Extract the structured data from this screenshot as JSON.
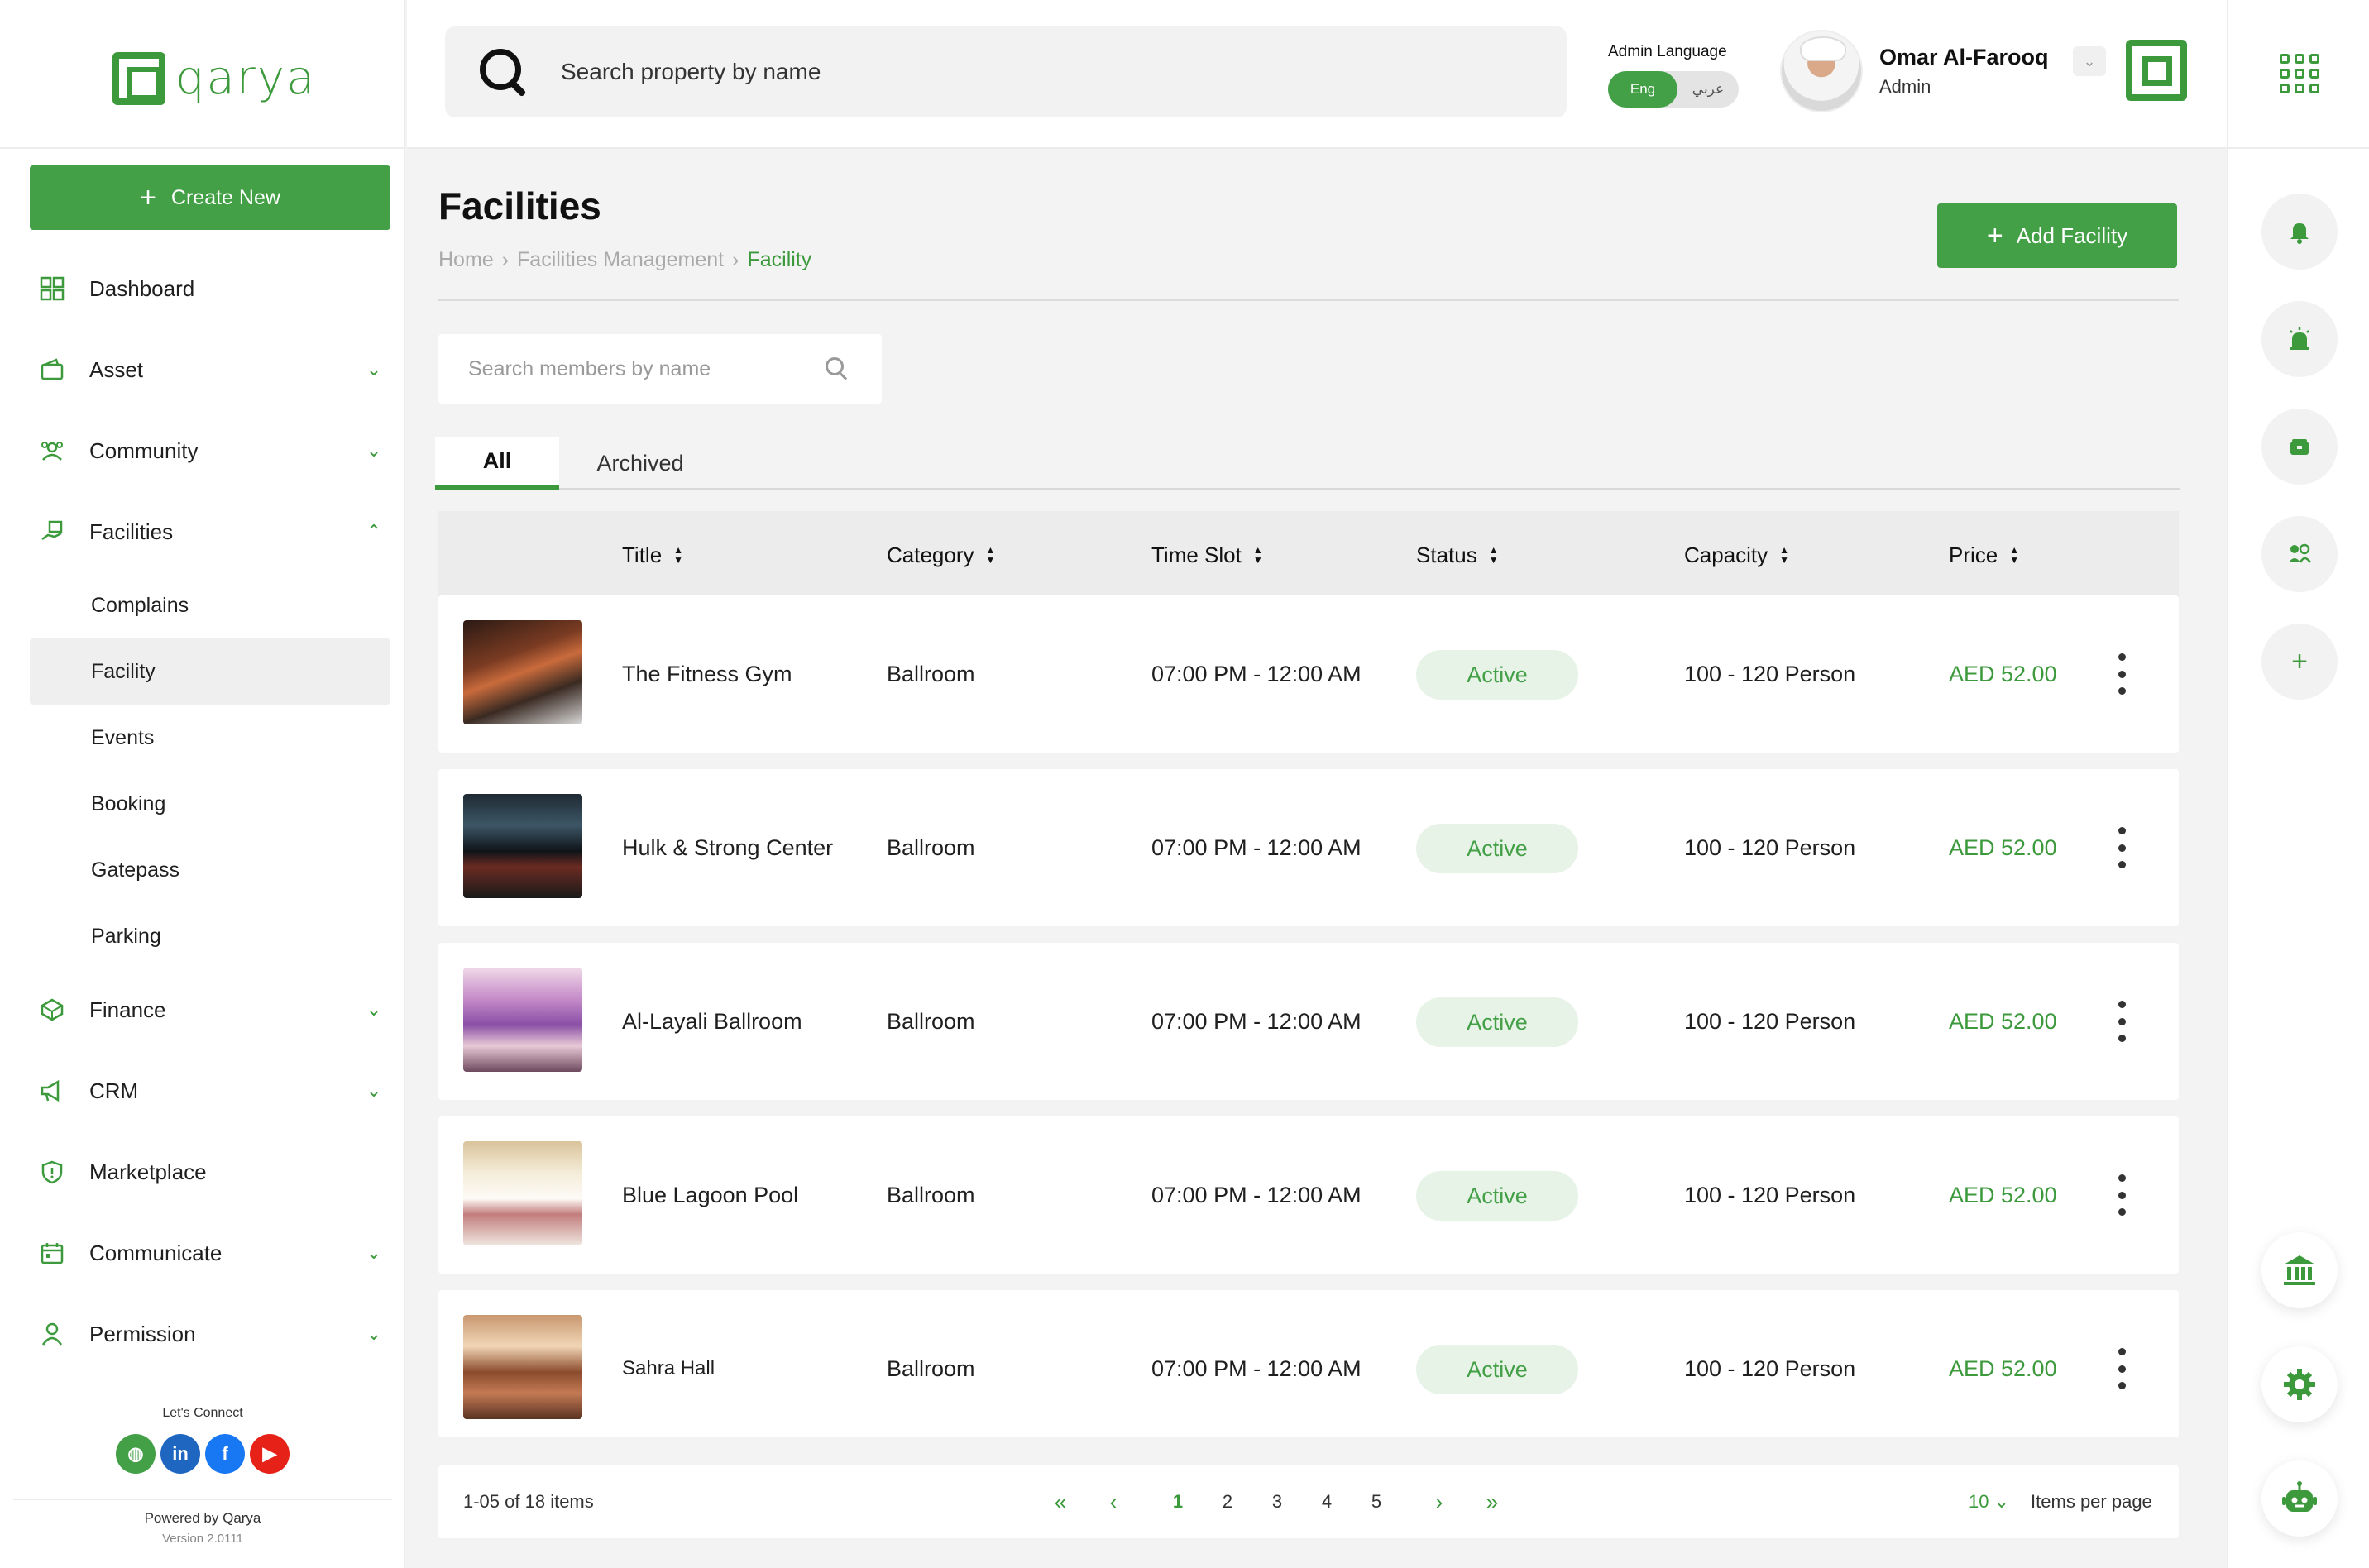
{
  "brand": {
    "name": "qarya",
    "accent": "#43a047"
  },
  "sidebar": {
    "create_label": "Create New",
    "items": [
      {
        "label": "Dashboard",
        "icon": "dashboard-icon",
        "has_chevron": false
      },
      {
        "label": "Asset",
        "icon": "wallet-icon",
        "has_chevron": true
      },
      {
        "label": "Community",
        "icon": "community-icon",
        "has_chevron": true
      },
      {
        "label": "Facilities",
        "icon": "hand-building-icon",
        "has_chevron": true,
        "expanded": true
      }
    ],
    "sub_items": [
      "Complains",
      "Facility",
      "Events",
      "Booking",
      "Gatepass",
      "Parking"
    ],
    "active_sub": "Facility",
    "items_after": [
      {
        "label": "Finance",
        "icon": "finance-icon",
        "has_chevron": true
      },
      {
        "label": "CRM",
        "icon": "megaphone-icon",
        "has_chevron": true
      },
      {
        "label": "Marketplace",
        "icon": "shield-icon",
        "has_chevron": false
      },
      {
        "label": "Communicate",
        "icon": "calendar-icon",
        "has_chevron": true
      },
      {
        "label": "Permission",
        "icon": "user-icon",
        "has_chevron": true
      }
    ],
    "lets_connect": "Let's Connect",
    "powered_by": "Powered by Qarya",
    "version": "Version 2.0111"
  },
  "header": {
    "search_placeholder": "Search property by name",
    "lang_label": "Admin Language",
    "lang_on": "Eng",
    "lang_off": "عربي",
    "user_name": "Omar Al-Farooq",
    "user_role": "Admin"
  },
  "page": {
    "title": "Facilities",
    "breadcrumb": [
      "Home",
      "Facilities Management",
      "Facility"
    ],
    "add_label": "Add Facility",
    "member_search_placeholder": "Search members by name",
    "tabs": [
      "All",
      "Archived"
    ],
    "active_tab": "All"
  },
  "table": {
    "columns": [
      "Title",
      "Category",
      "Time Slot",
      "Status",
      "Capacity",
      "Price"
    ],
    "rows": [
      {
        "title": "The Fitness Gym",
        "category": "Ballroom",
        "time_slot": "07:00 PM - 12:00 AM",
        "status": "Active",
        "capacity": "100 - 120 Person",
        "price": "AED 52.00"
      },
      {
        "title": "Hulk & Strong Center",
        "category": "Ballroom",
        "time_slot": "07:00 PM - 12:00 AM",
        "status": "Active",
        "capacity": "100 - 120 Person",
        "price": "AED 52.00"
      },
      {
        "title": "Al-Layali Ballroom",
        "category": "Ballroom",
        "time_slot": "07:00 PM - 12:00 AM",
        "status": "Active",
        "capacity": "100 - 120 Person",
        "price": "AED 52.00"
      },
      {
        "title": "Blue Lagoon Pool",
        "category": "Ballroom",
        "time_slot": "07:00 PM - 12:00 AM",
        "status": "Active",
        "capacity": "100 - 120 Person",
        "price": "AED 52.00"
      },
      {
        "title": "Sahra Hall",
        "category": "Ballroom",
        "time_slot": "07:00 PM - 12:00 AM",
        "status": "Active",
        "capacity": "100 - 120 Person",
        "price": "AED 52.00"
      }
    ]
  },
  "pagination": {
    "summary": "1-05 of 18 items",
    "first": "«",
    "prev": "‹",
    "pages": [
      "1",
      "2",
      "3",
      "4",
      "5"
    ],
    "active_page": "1",
    "next": "›",
    "last": "»",
    "per_page": "10",
    "per_page_label": "Items per page"
  }
}
